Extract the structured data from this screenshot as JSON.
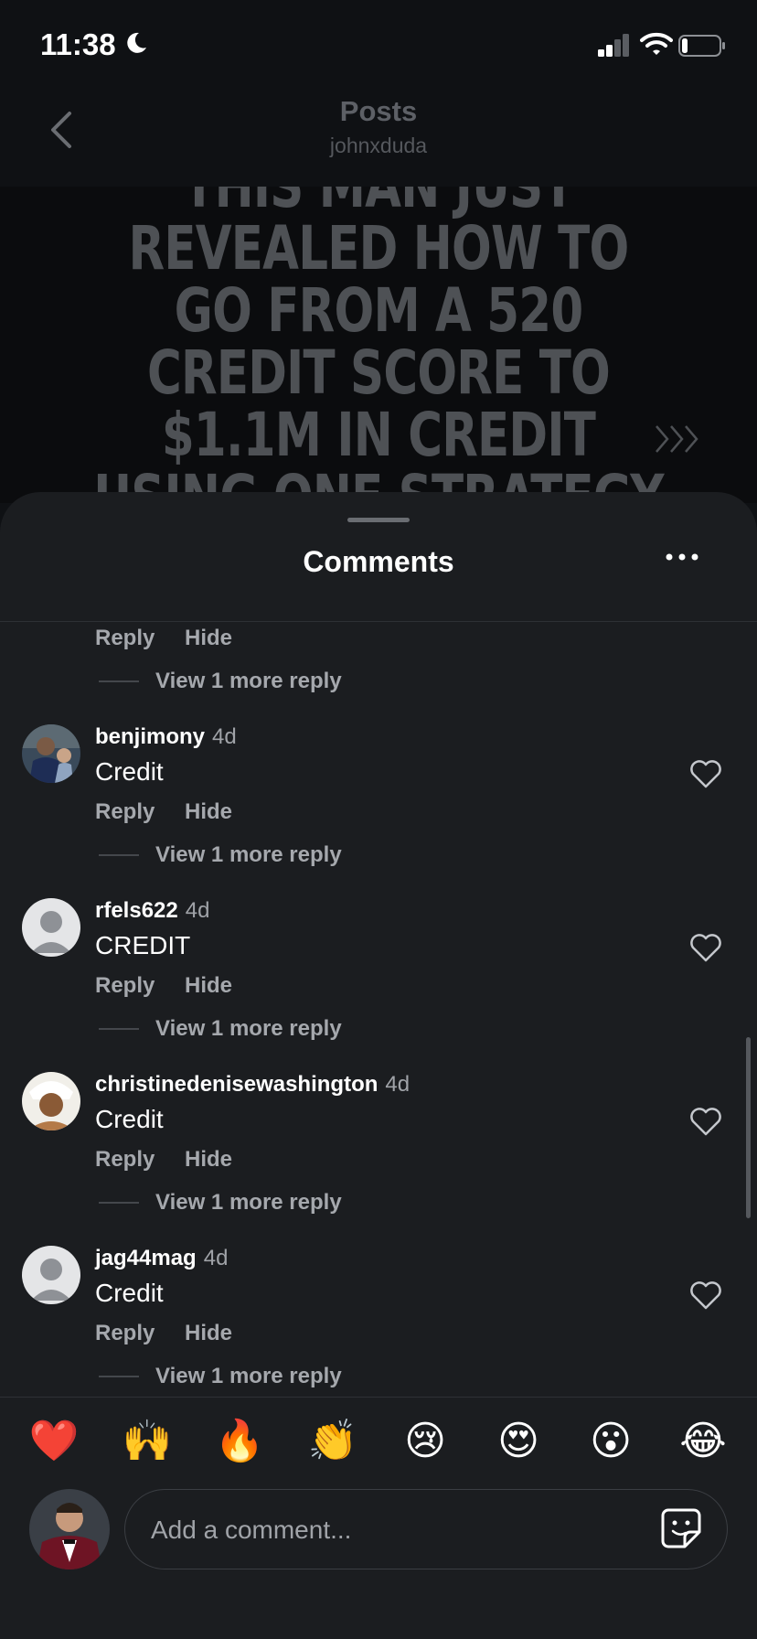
{
  "status_bar": {
    "time": "11:38"
  },
  "header": {
    "title": "Posts",
    "subtitle": "johnxduda"
  },
  "post": {
    "headline": "THIS MAN JUST REVEALED HOW TO GO FROM A 520 CREDIT SCORE TO $1.1M IN CREDIT USING ONE STRATEGY"
  },
  "sheet": {
    "title": "Comments"
  },
  "top_thread": {
    "reply_label": "Reply",
    "hide_label": "Hide",
    "view_more": "View 1 more reply"
  },
  "comments": [
    {
      "username": "benjimony",
      "time": "4d",
      "text": "Credit",
      "reply_label": "Reply",
      "hide_label": "Hide",
      "view_more": "View 1 more reply"
    },
    {
      "username": "rfels622",
      "time": "4d",
      "text": "CREDIT",
      "reply_label": "Reply",
      "hide_label": "Hide",
      "view_more": "View 1 more reply"
    },
    {
      "username": "christinedenisewashington",
      "time": "4d",
      "text": "Credit",
      "reply_label": "Reply",
      "hide_label": "Hide",
      "view_more": "View 1 more reply"
    },
    {
      "username": "jag44mag",
      "time": "4d",
      "text": "Credit",
      "reply_label": "Reply",
      "hide_label": "Hide",
      "view_more": "View 1 more reply"
    }
  ],
  "emoji_bar": [
    "❤️",
    "🙌",
    "🔥",
    "👏",
    "😢",
    "😍",
    "😮",
    "😂"
  ],
  "composer": {
    "placeholder": "Add a comment..."
  },
  "colors": {
    "background": "#0f1114",
    "sheet": "#1b1d20",
    "muted_text": "#a5a8ad"
  }
}
